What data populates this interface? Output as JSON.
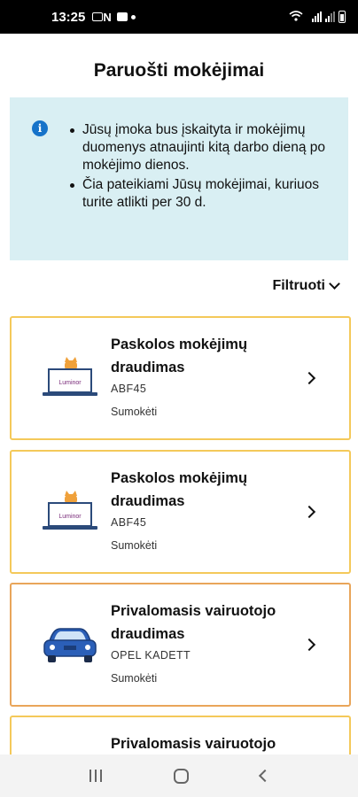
{
  "status_bar": {
    "time": "13:25"
  },
  "header": {
    "title": "Paruošti mokėjimai"
  },
  "info": {
    "bullets": [
      "Jūsų įmoka bus įskaityta ir mokėjimų duomenys atnaujinti kitą darbo dieną po mokėjimo dienos.",
      "Čia pateikiami Jūsų mokėjimai, kuriuos turite atlikti per 30 d."
    ]
  },
  "filter": {
    "label": "Filtruoti"
  },
  "cards": [
    {
      "title": "Paskolos mokėjimų draudimas",
      "subtitle": "ABF45",
      "action": "Sumokėti",
      "icon": "luminor-laptop-cat-icon",
      "logo_text": "Luminor"
    },
    {
      "title": "Paskolos mokėjimų draudimas",
      "subtitle": "ABF45",
      "action": "Sumokėti",
      "icon": "luminor-laptop-cat-icon",
      "logo_text": "Luminor"
    },
    {
      "title": "Privalomasis vairuotojo draudimas",
      "subtitle": "OPEL KADETT",
      "action": "Sumokėti",
      "icon": "blue-car-icon"
    },
    {
      "title": "Privalomasis vairuotojo"
    }
  ],
  "colors": {
    "card_border": "#f4c95a",
    "card_border_selected": "#e9a55a",
    "info_bg": "#d9eff3",
    "info_icon": "#1673c9"
  }
}
